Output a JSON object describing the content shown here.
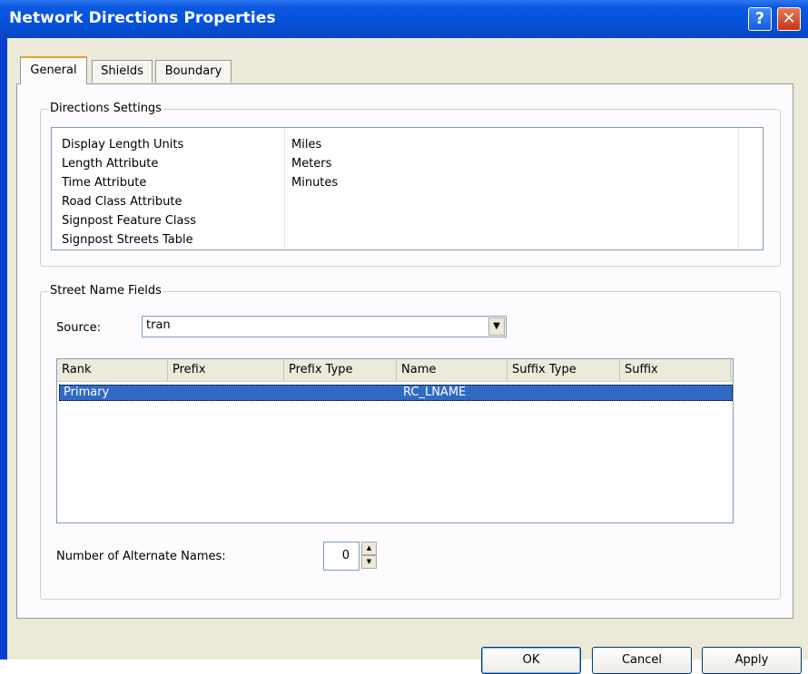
{
  "window": {
    "title": "Network Directions Properties",
    "help_glyph": "?",
    "close_glyph": "✕"
  },
  "tabs": [
    {
      "label": "General"
    },
    {
      "label": "Shields"
    },
    {
      "label": "Boundary"
    }
  ],
  "directions_settings": {
    "legend": "Directions Settings",
    "rows": [
      {
        "name": "Display Length Units",
        "value": "Miles"
      },
      {
        "name": "Length Attribute",
        "value": "Meters"
      },
      {
        "name": "Time Attribute",
        "value": "Minutes"
      },
      {
        "name": "Road Class Attribute",
        "value": ""
      },
      {
        "name": "Signpost Feature Class",
        "value": ""
      },
      {
        "name": "Signpost Streets Table",
        "value": ""
      }
    ]
  },
  "street_name_fields": {
    "legend": "Street Name Fields",
    "source_label": "Source:",
    "source_value": "tran",
    "columns": [
      "Rank",
      "Prefix",
      "Prefix Type",
      "Name",
      "Suffix Type",
      "Suffix"
    ],
    "rows": [
      {
        "rank": "Primary",
        "prefix": "",
        "prefix_type": "",
        "name": "RC_LNAME",
        "suffix_type": "",
        "suffix": ""
      }
    ],
    "alternates_label": "Number of Alternate Names:",
    "alternates_value": "0"
  },
  "buttons": {
    "ok": "OK",
    "cancel": "Cancel",
    "apply": "Apply"
  }
}
